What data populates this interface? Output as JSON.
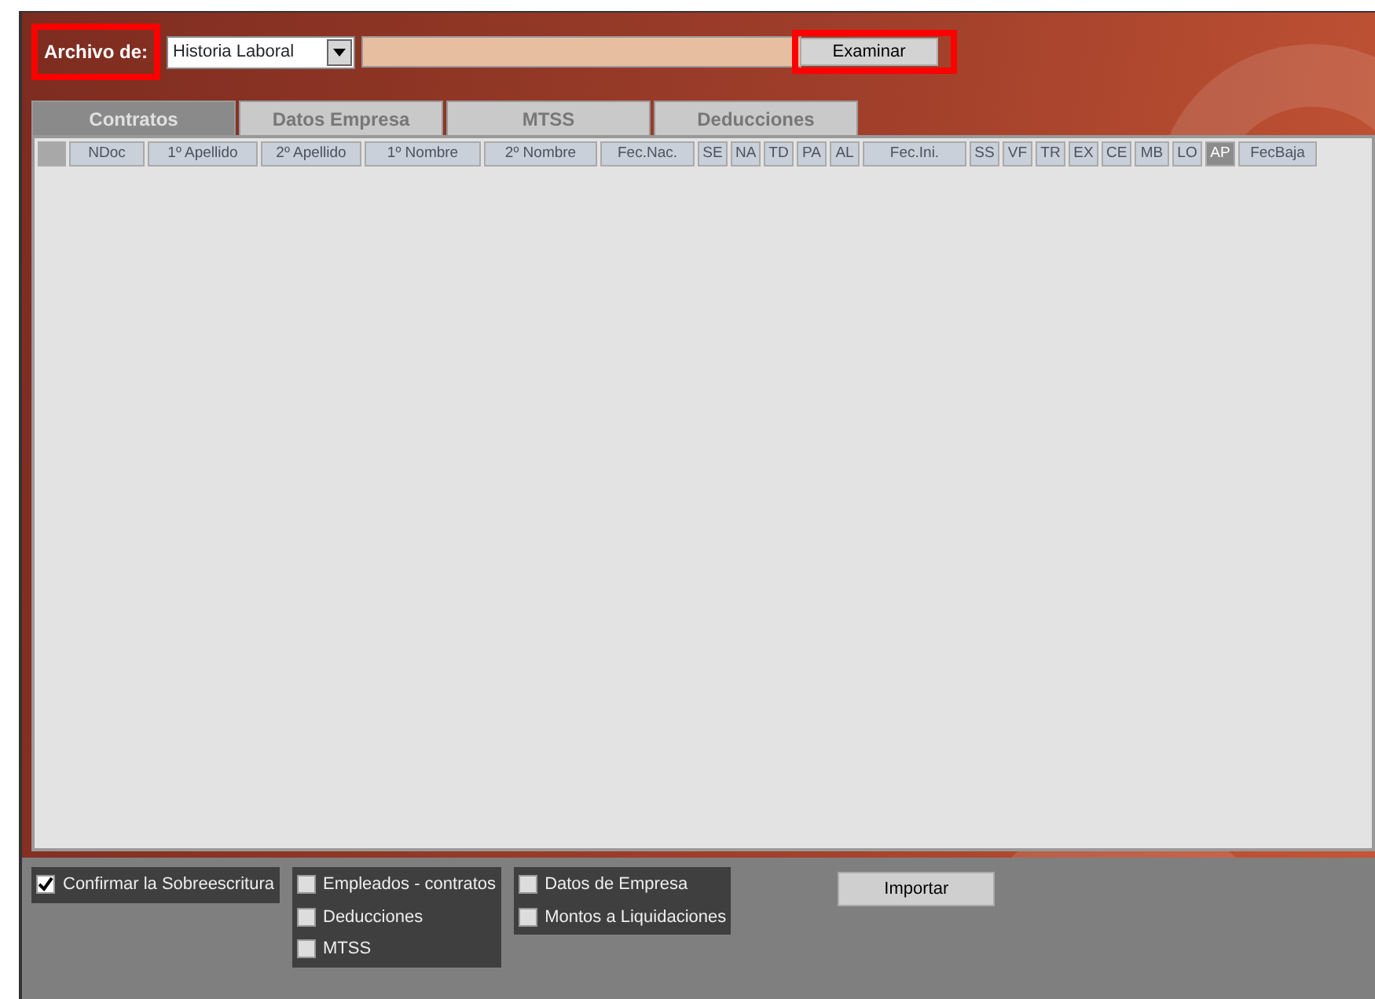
{
  "file_bar": {
    "label": "Archivo de:",
    "label_highlighted": true,
    "type_select": "Historia Laboral",
    "browse_button": "Examinar",
    "browse_highlighted": true
  },
  "tabs": [
    {
      "label": "Contratos",
      "selected": true
    },
    {
      "label": "Datos Empresa",
      "selected": false
    },
    {
      "label": "MTSS",
      "selected": false
    },
    {
      "label": "Deducciones",
      "selected": false
    }
  ],
  "table": {
    "columns": [
      {
        "label": "NDoc",
        "selected": false
      },
      {
        "label": "1º Apellido",
        "selected": false
      },
      {
        "label": "2º Apellido",
        "selected": false
      },
      {
        "label": "1º Nombre",
        "selected": false
      },
      {
        "label": "2º Nombre",
        "selected": false
      },
      {
        "label": "Fec.Nac.",
        "selected": false
      },
      {
        "label": "SE",
        "selected": false
      },
      {
        "label": "NA",
        "selected": false
      },
      {
        "label": "TD",
        "selected": false
      },
      {
        "label": "PA",
        "selected": false
      },
      {
        "label": "AL",
        "selected": false
      },
      {
        "label": "Fec.Ini.",
        "selected": false
      },
      {
        "label": "SS",
        "selected": false
      },
      {
        "label": "VF",
        "selected": false
      },
      {
        "label": "TR",
        "selected": false
      },
      {
        "label": "EX",
        "selected": false
      },
      {
        "label": "CE",
        "selected": false
      },
      {
        "label": "MB",
        "selected": false
      },
      {
        "label": "LO",
        "selected": false
      },
      {
        "label": "AP",
        "selected": true
      },
      {
        "label": "FecBaja",
        "selected": false
      }
    ]
  },
  "options": {
    "groups": [
      [
        {
          "label": "Confirmar la Sobreescritura",
          "checked": true
        }
      ],
      [
        {
          "label": "Empleados - contratos",
          "checked": false
        },
        {
          "label": "Deducciones",
          "checked": false
        },
        {
          "label": "MTSS",
          "checked": false
        }
      ],
      [
        {
          "label": "Datos de Empresa",
          "checked": false
        },
        {
          "label": "Montos a Liquidaciones",
          "checked": false
        }
      ]
    ],
    "import_button": "Importar"
  }
}
